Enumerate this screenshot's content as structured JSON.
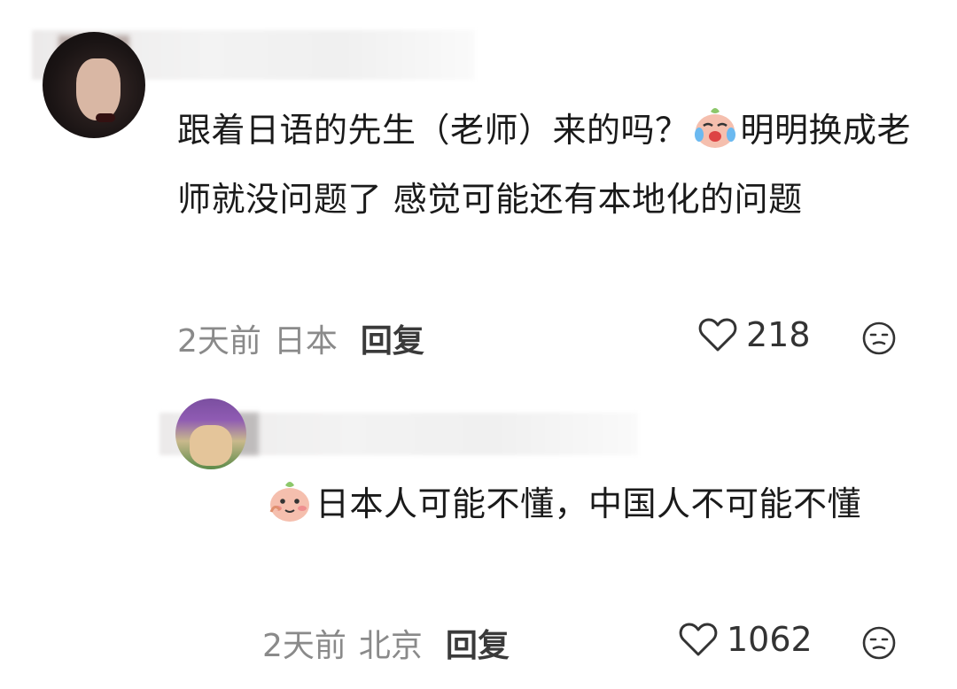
{
  "comments": [
    {
      "text_parts": [
        "跟着日语的先生（老师）来的吗？",
        "明明换成老师就没问题了 感觉可能还有本地化的问题"
      ],
      "emoji": "crying-laugh-emoji",
      "time": "2天前",
      "location": "日本",
      "reply_label": "回复",
      "likes": "218",
      "icons": [
        "heart-icon",
        "meh-face-icon"
      ]
    },
    {
      "text_parts": [
        "",
        "日本人可能不懂，中国人不可能不懂"
      ],
      "emoji": "peach-cheek-emoji",
      "time": "2天前",
      "location": "北京",
      "reply_label": "回复",
      "likes": "1062",
      "icons": [
        "heart-icon",
        "meh-face-icon"
      ]
    }
  ],
  "colors": {
    "text": "#1a1a1a",
    "meta": "#8a8a8a",
    "reply": "#3a3a3a",
    "emoji_face": "#f3b8a6"
  }
}
